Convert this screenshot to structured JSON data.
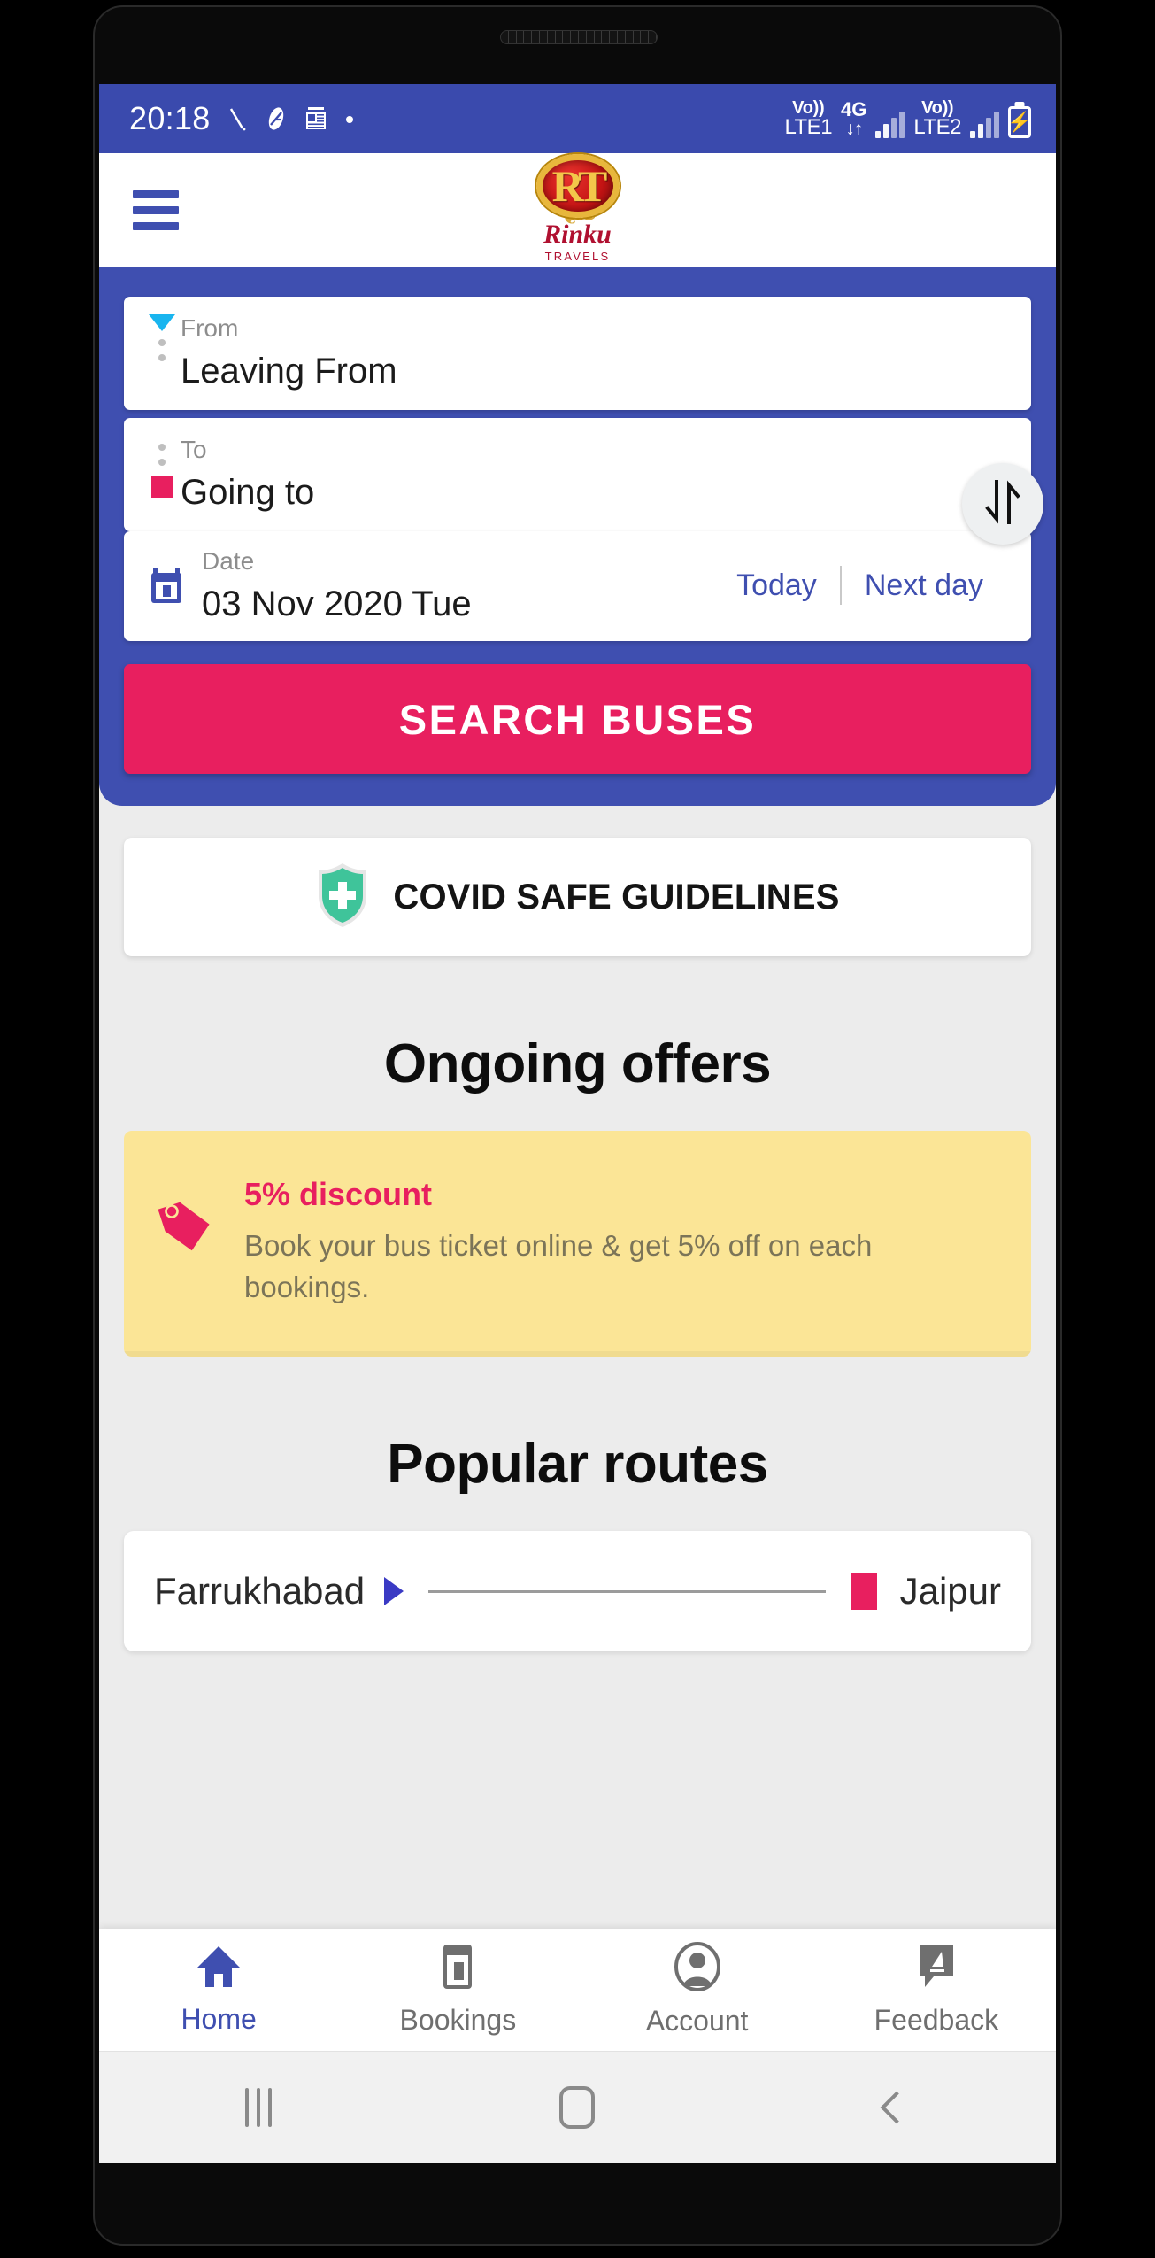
{
  "status_bar": {
    "clock": "20:18",
    "icons": [
      "alarm-slash-icon",
      "feather-icon",
      "calendar-note-icon",
      "dot-icon"
    ],
    "sim1_voice": "Vo))",
    "sim1_label": "LTE1",
    "network_type": "4G",
    "data_arrows": "↓↑",
    "sim2_voice": "Vo))",
    "sim2_label": "LTE2",
    "battery_state": "charging"
  },
  "appbar": {
    "menu_icon": "hamburger-menu-icon",
    "logo_monogram": "RT",
    "logo_name": "Rinku",
    "logo_sub": "TRAVELS"
  },
  "search": {
    "from": {
      "label": "From",
      "value": "Leaving From",
      "placeholder": "Leaving From"
    },
    "to": {
      "label": "To",
      "value": "Going to",
      "placeholder": "Going to"
    },
    "swap_icon": "swap-vertical-icon",
    "date": {
      "label": "Date",
      "value": "03 Nov 2020 Tue",
      "today_label": "Today",
      "next_day_label": "Next day",
      "icon": "calendar-icon"
    },
    "submit_label": "SEARCH BUSES"
  },
  "covid": {
    "label": "COVID SAFE GUIDELINES",
    "icon": "shield-plus-icon",
    "icon_color": "#3fc49a"
  },
  "offers": {
    "heading": "Ongoing offers",
    "items": [
      {
        "icon": "price-tag-icon",
        "title": "5% discount",
        "description": "Book your bus ticket online & get 5% off on each bookings."
      }
    ]
  },
  "routes": {
    "heading": "Popular routes",
    "items": [
      {
        "origin": "Farrukhabad",
        "destination": "Jaipur"
      }
    ]
  },
  "bottom_nav": {
    "items": [
      {
        "label": "Home",
        "icon": "home-icon",
        "active": true
      },
      {
        "label": "Bookings",
        "icon": "ticket-icon",
        "active": false
      },
      {
        "label": "Account",
        "icon": "person-circle-icon",
        "active": false
      },
      {
        "label": "Feedback",
        "icon": "feedback-pencil-icon",
        "active": false
      }
    ]
  },
  "android_nav": {
    "recents": "recents-icon",
    "home": "home-pill-icon",
    "back": "back-chevron-icon"
  },
  "colors": {
    "primary_blue": "#3f4fb0",
    "status_blue": "#3a4aad",
    "accent_pink": "#e81f5f",
    "offer_yellow": "#fbe596",
    "page_bg": "#ececec",
    "cyan_marker": "#19b5ef",
    "shield_green": "#3fc49a"
  }
}
